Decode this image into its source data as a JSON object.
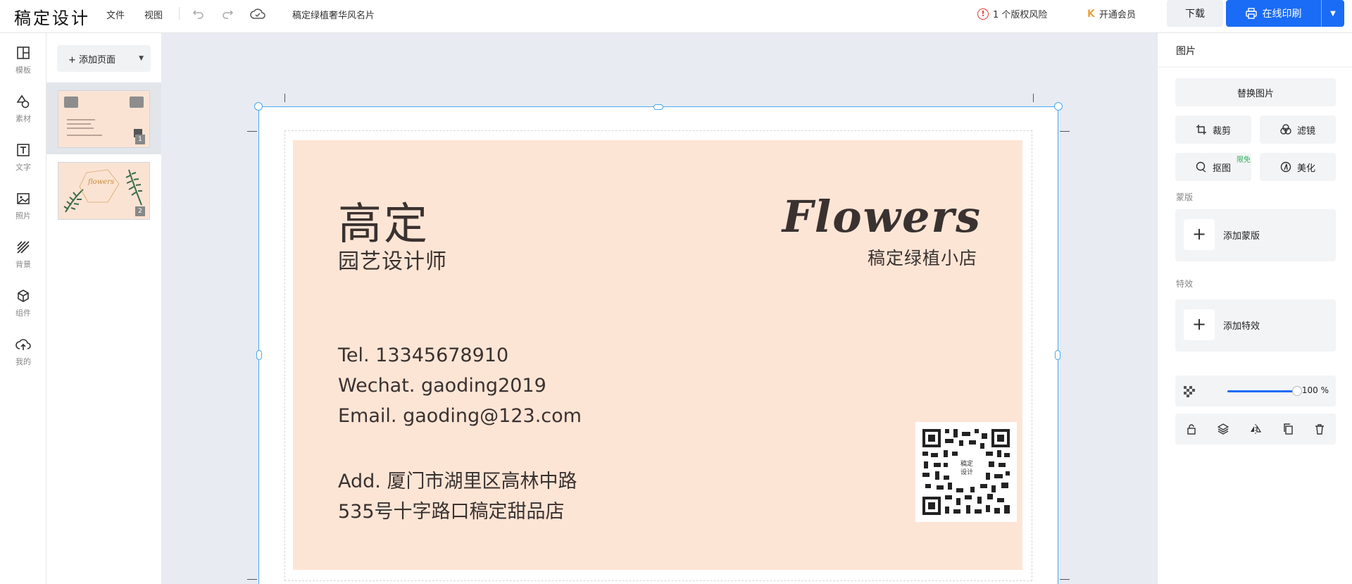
{
  "app": {
    "logo": "稿定设计",
    "menu": [
      "文件",
      "视图"
    ],
    "doc_title": "稿定绿植奢华风名片",
    "risk_text": "1 个版权风险",
    "vip_text": "开通会员",
    "download_label": "下载",
    "print_label": "在线印刷"
  },
  "sidebar": {
    "items": [
      {
        "label": "模板",
        "icon": "template-icon"
      },
      {
        "label": "素材",
        "icon": "shapes-icon"
      },
      {
        "label": "文字",
        "icon": "text-icon"
      },
      {
        "label": "照片",
        "icon": "image-icon"
      },
      {
        "label": "背景",
        "icon": "background-icon"
      },
      {
        "label": "组件",
        "icon": "component-icon"
      },
      {
        "label": "我的",
        "icon": "cloud-upload-icon"
      }
    ]
  },
  "pages": {
    "add_label": "+ 添加页面",
    "thumbs": [
      {
        "num": "1",
        "selected": true
      },
      {
        "num": "2",
        "selected": false
      }
    ]
  },
  "card": {
    "title": "高定",
    "subtitle": "园艺设计师",
    "brand": "Flowers",
    "brand_sub": "稿定绿植小店",
    "tel": "Tel. 13345678910",
    "wechat": "Wechat. gaoding2019",
    "email": "Email. gaoding@123.com",
    "addr1": "Add. 厦门市湖里区高林中路",
    "addr2": "535号十字路口稿定甜品店",
    "qr_center": "稿定\n设计",
    "bg_color": "#fde5d6",
    "text_color": "#3a3230"
  },
  "panel": {
    "title": "图片",
    "replace_label": "替换图片",
    "crop_label": "裁剪",
    "filter_label": "滤镜",
    "cutout_label": "抠图",
    "cutout_badge": "限免",
    "beautify_label": "美化",
    "mask_section": "蒙版",
    "add_mask_label": "添加蒙版",
    "effect_section": "特效",
    "add_effect_label": "添加特效",
    "opacity_value": "100 %",
    "opacity_fraction": 1.0
  },
  "colors": {
    "accent": "#1a6cf6",
    "selection": "#49a8f2",
    "risk": "#e53935"
  }
}
